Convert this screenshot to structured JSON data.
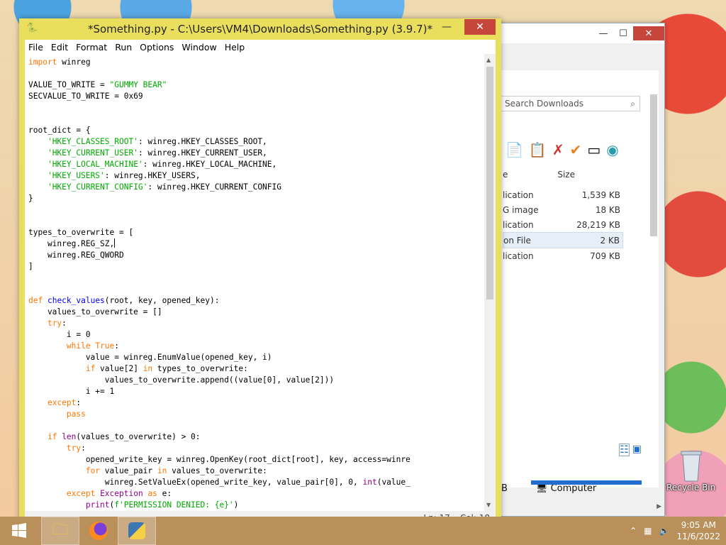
{
  "desktop": {
    "recycle_bin_label": "Recycle Bin"
  },
  "explorer": {
    "search_placeholder": "Search Downloads",
    "size_column": "Size",
    "rows": [
      {
        "type": "lication",
        "size": "1,539 KB"
      },
      {
        "type": "G image",
        "size": "18 KB"
      },
      {
        "type": "lication",
        "size": "28,219 KB"
      },
      {
        "type": "on File",
        "size": "2 KB"
      },
      {
        "type": "lication",
        "size": "709 KB"
      }
    ],
    "status_left": "B",
    "status_location": "Computer"
  },
  "idle": {
    "title": "*Something.py - C:\\Users\\VM4\\Downloads\\Something.py (3.9.7)*",
    "menu": [
      "File",
      "Edit",
      "Format",
      "Run",
      "Options",
      "Window",
      "Help"
    ],
    "status_line": "Ln: 17",
    "status_col": "Col: 18"
  },
  "taskbar": {
    "time": "9:05 AM",
    "date": "11/6/2022"
  },
  "colors": {
    "idle_frame": "#eadf5d",
    "keyword": "#ff7700",
    "string": "#00aa00",
    "definition": "#0000ff",
    "builtin": "#900090",
    "taskbar": "#b98f5a"
  }
}
